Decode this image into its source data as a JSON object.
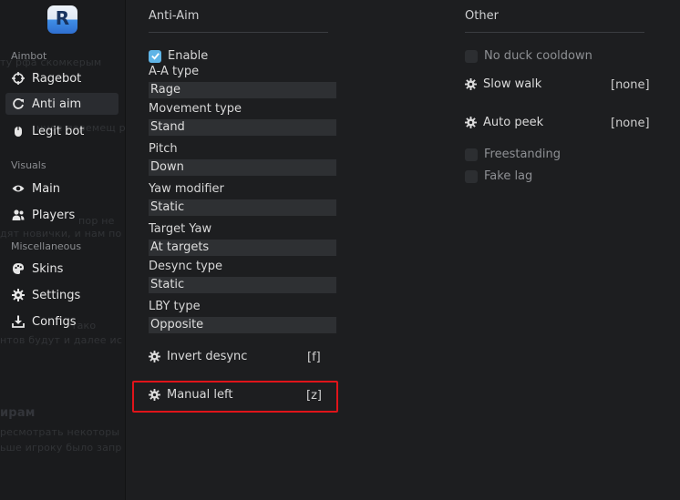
{
  "sidebar": {
    "logo_letter": "R",
    "sections": [
      "Aimbot",
      "Visuals",
      "Miscellaneous"
    ],
    "items": [
      {
        "label": "Ragebot",
        "icon": "crosshair-icon",
        "active": false
      },
      {
        "label": "Anti aim",
        "icon": "spin-icon",
        "active": true
      },
      {
        "label": "Legit bot",
        "icon": "mouse-icon",
        "active": false
      },
      {
        "label": "Main",
        "icon": "eye-icon",
        "active": false
      },
      {
        "label": "Players",
        "icon": "users-icon",
        "active": false
      },
      {
        "label": "Skins",
        "icon": "palette-icon",
        "active": false
      },
      {
        "label": "Settings",
        "icon": "gear-icon",
        "active": false
      },
      {
        "label": "Configs",
        "icon": "download-icon",
        "active": false
      }
    ],
    "ghost_text": [
      "ту рфа скомкерым",
      "нное перемещ руки",
      "пор не",
      "дят новички, и нам по",
      "тако",
      "нтов будут и далее ис",
      "ирам",
      "ресмотрать некоторы",
      "ьше игроку было запр"
    ]
  },
  "anti_aim": {
    "title": "Anti-Aim",
    "enable_label": "Enable",
    "enable_checked": true,
    "fields": [
      {
        "label": "A-A type",
        "value": "Rage"
      },
      {
        "label": "Movement type",
        "value": "Stand"
      },
      {
        "label": "Pitch",
        "value": "Down"
      },
      {
        "label": "Yaw modifier",
        "value": "Static"
      },
      {
        "label": "Target Yaw",
        "value": "At targets"
      },
      {
        "label": "Desync type",
        "value": "Static"
      },
      {
        "label": "LBY type",
        "value": "Opposite"
      }
    ],
    "invert_desync": {
      "label": "Invert desync",
      "key": "[f]"
    },
    "manual_left": {
      "label": "Manual left",
      "key": "[z]"
    }
  },
  "other": {
    "title": "Other",
    "no_duck": "No duck cooldown",
    "slow_walk": {
      "label": "Slow walk",
      "key": "[none]"
    },
    "auto_peek": {
      "label": "Auto peek",
      "key": "[none]"
    },
    "freestanding": "Freestanding",
    "fake_lag": "Fake lag"
  },
  "colors": {
    "accent": "#5fb4e6",
    "highlight": "#e0141a"
  }
}
